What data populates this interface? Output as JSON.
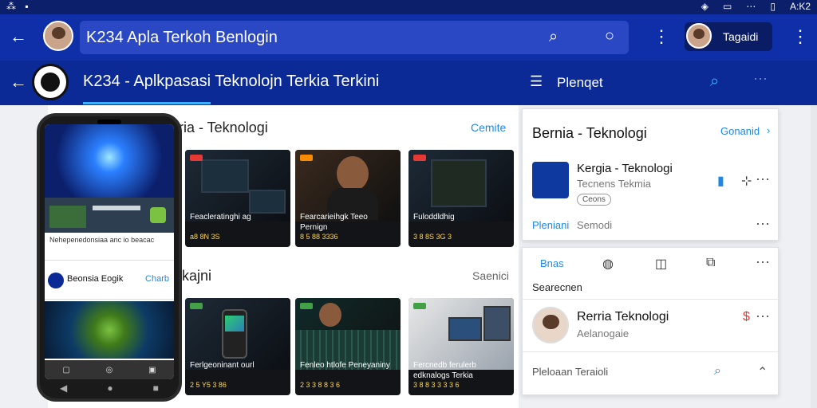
{
  "status_bar": {
    "right_text": "A:K2"
  },
  "top_bar": {
    "search_value": "K234 Apla Terkoh Benlogin",
    "account_label": "Tagaidi"
  },
  "app_bar": {
    "title": "K234  -  Aplkpasasi Teknolojn Terkia Terkini",
    "menu_label": "Plenqet"
  },
  "main": {
    "section1": {
      "title": "ria - Teknologi",
      "link": "Cemite"
    },
    "section2": {
      "title": "jkajni",
      "link": "Saenici"
    },
    "cards_row1": [
      {
        "title": "Feacleratinghi ag",
        "meta": "a8 8N 3S"
      },
      {
        "title": "Fearcarieihgk Teeo Pernign",
        "meta": "8 5 88 3336"
      },
      {
        "title": "Fuloddldhig",
        "meta": "3 8 8S 3G 3"
      }
    ],
    "cards_row2": [
      {
        "title": "Ferlgeoninant ourl",
        "meta": "2 5 Y5 3 86"
      },
      {
        "title": "Fenleo htlofe Peneyaniny",
        "meta": "2 3 3 8 8 3 6"
      },
      {
        "title": "Fercnedb ferulerb edknalogs Terkia",
        "meta": "3 8 8 3 3 3 3 6"
      }
    ]
  },
  "phone": {
    "strip_line": "Nehepenedonsiaa anc io beacac",
    "card_title": "Beonsia Eogik",
    "card_link": "Charb"
  },
  "right_panel": {
    "card1": {
      "title": "Bernia - Teknologi",
      "link": "Gonanid",
      "item_title": "Kergia - Teknologi",
      "item_sub": "Tecnens Tekmia",
      "item_badge": "Ceons",
      "foot_left": "Pleniani",
      "foot_right": "Semodi"
    },
    "card2": {
      "tab_label": "Bnas",
      "section_label": "Searecnen",
      "person_title": "Rerria Teknologi",
      "person_sub": "Aelanogaie",
      "footer_text": "Pleloaan Teraioli"
    }
  }
}
